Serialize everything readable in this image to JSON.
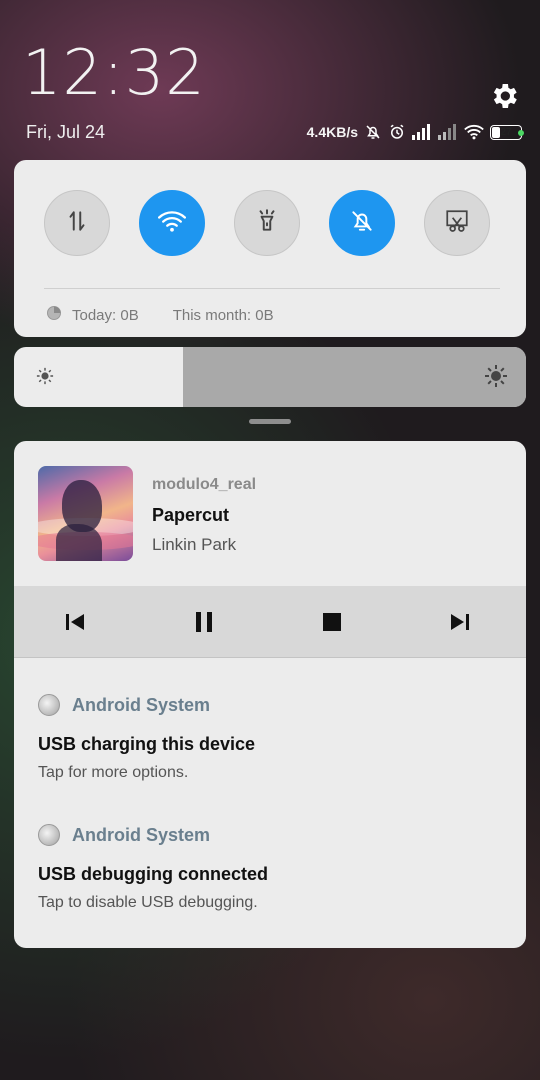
{
  "status": {
    "time": "12:32",
    "date": "Fri, Jul 24",
    "net_speed": "4.4KB/s",
    "battery_level": "27",
    "icons": [
      "settings-icon",
      "mute-icon",
      "alarm-icon",
      "signal-icon",
      "signal-2-icon",
      "wifi-icon",
      "battery-icon"
    ]
  },
  "quick_settings": {
    "toggles": [
      {
        "name": "data-transfer",
        "icon": "data-arrows-icon",
        "on": false
      },
      {
        "name": "wifi",
        "icon": "wifi-icon",
        "on": true
      },
      {
        "name": "flashlight",
        "icon": "flashlight-icon",
        "on": false
      },
      {
        "name": "silent",
        "icon": "bell-off-icon",
        "on": true
      },
      {
        "name": "screenshot",
        "icon": "screenshot-scissors-icon",
        "on": false
      }
    ],
    "usage_today": "Today: 0B",
    "usage_month": "This month: 0B"
  },
  "brightness": {
    "level": 0.33
  },
  "media": {
    "app": "modulo4_real",
    "title": "Papercut",
    "artist": "Linkin Park",
    "controls": [
      "previous-icon",
      "pause-icon",
      "stop-icon",
      "next-icon"
    ]
  },
  "notifications": [
    {
      "app": "Android System",
      "title": "USB charging this device",
      "text": "Tap for more options."
    },
    {
      "app": "Android System",
      "title": "USB debugging connected",
      "text": "Tap to disable USB debugging."
    }
  ],
  "colors": {
    "accent": "#1e96f0",
    "card": "#ececec",
    "app_label": "#6a7f8e"
  }
}
